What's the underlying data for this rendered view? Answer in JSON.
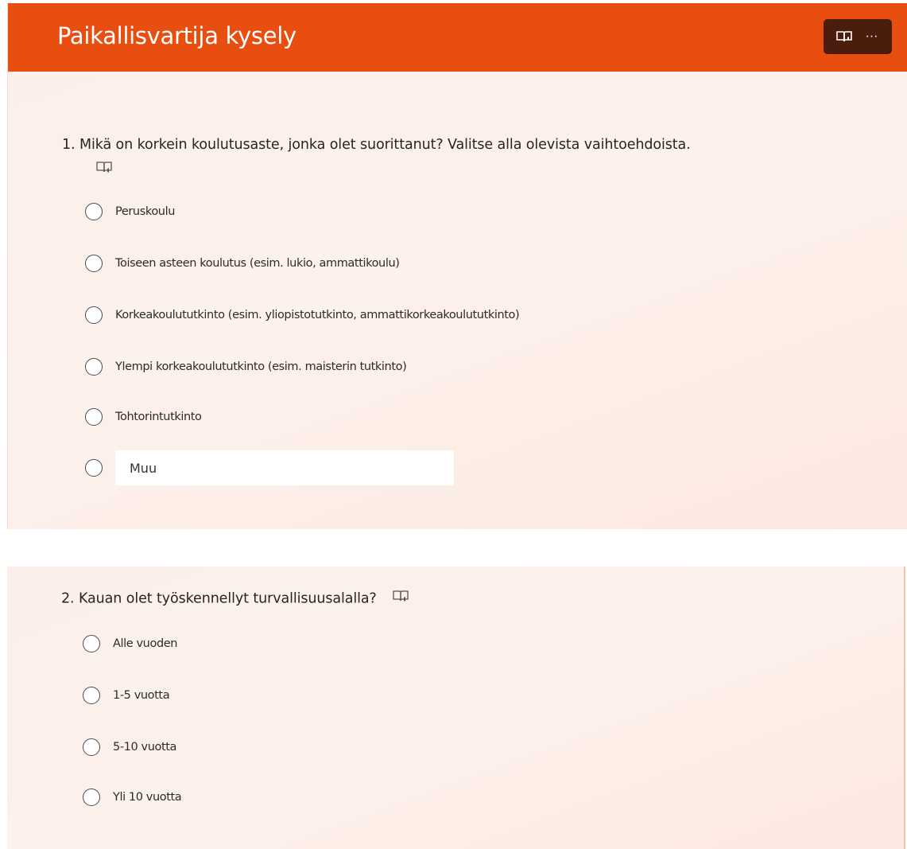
{
  "form": {
    "title": "Paikallisvartija kysely",
    "header_buttons": [
      {
        "icon": "immersive-reader-icon"
      },
      {
        "label": "···",
        "icon": "more-options-icon"
      }
    ]
  },
  "questions": [
    {
      "text": "1. Mikä on korkein koulutusaste, jonka olet suorittanut? Valitse alla olevista vaihtoehdoista.",
      "options": [
        "Peruskoulu",
        "Toiseen asteen koulutus (esim. lukio, ammattikoulu)",
        "Korkeakoulututkinto (esim. yliopistotutkinto, ammattikorkeakoulututkinto)",
        "Ylempi korkeakoulututkinto (esim. maisterin tutkinto)",
        "Tohtorintutkinto"
      ],
      "other_placeholder": "Muu"
    },
    {
      "text": "2. Kauan olet työskennellyt turvallisuusalalla?",
      "options": [
        "Alle vuoden",
        "1-5 vuotta",
        "5-10 vuotta",
        "Yli 10 vuotta"
      ]
    }
  ],
  "colors": {
    "header": "#e84e0f",
    "header_actions": "#4a1d0d",
    "card_background": "#fcefe9"
  }
}
